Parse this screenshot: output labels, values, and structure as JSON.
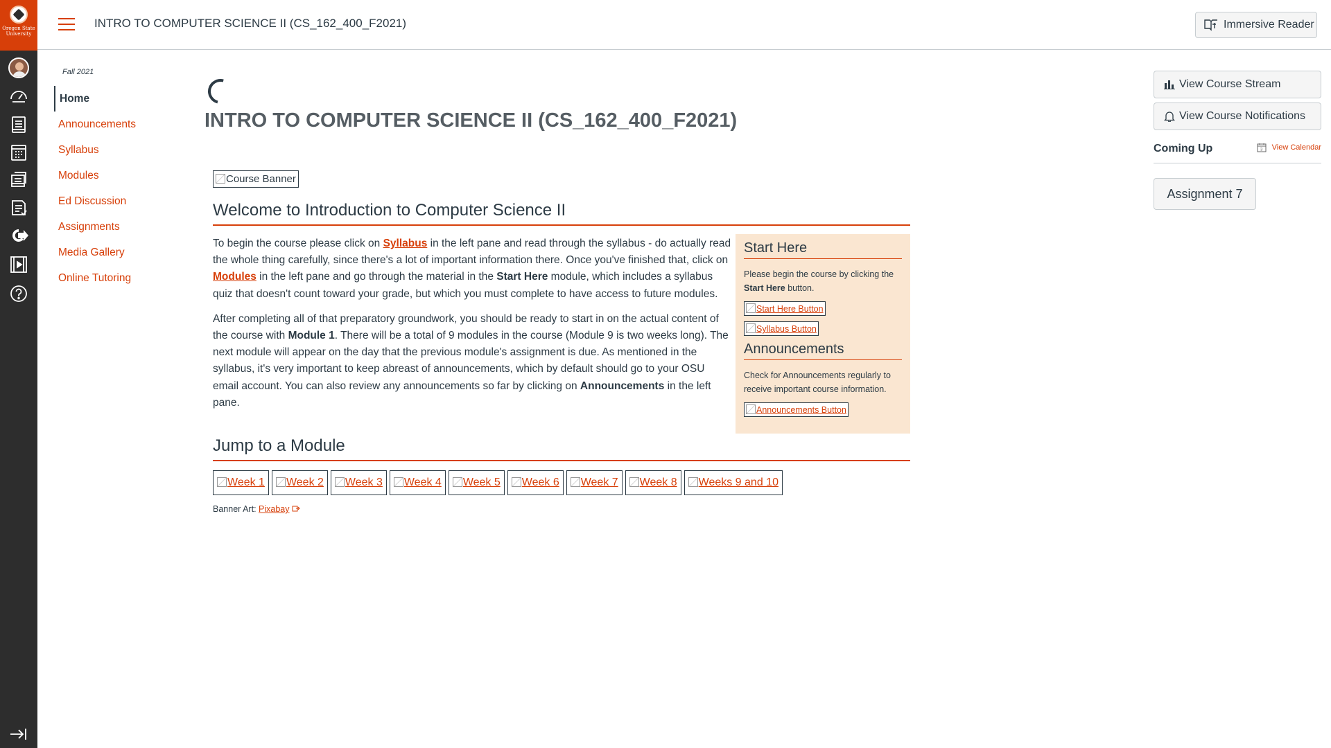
{
  "global_nav": {
    "logo_text": "Oregon State University",
    "items": [
      {
        "name": "account",
        "icon": "avatar-icon"
      },
      {
        "name": "dashboard",
        "icon": "dashboard-icon"
      },
      {
        "name": "courses",
        "icon": "courses-icon"
      },
      {
        "name": "calendar",
        "icon": "calendar-icon"
      },
      {
        "name": "inbox",
        "icon": "inbox-icon"
      },
      {
        "name": "history",
        "icon": "history-icon"
      },
      {
        "name": "commons",
        "icon": "commons-icon"
      },
      {
        "name": "studio",
        "icon": "studio-icon"
      },
      {
        "name": "help",
        "icon": "help-icon"
      }
    ],
    "collapse_icon": "collapse-nav-icon"
  },
  "header": {
    "course_title": "INTRO TO COMPUTER SCIENCE II (CS_162_400_F2021)",
    "immersive_reader": "Immersive Reader"
  },
  "course_nav": {
    "term": "Fall 2021",
    "items": [
      "Home",
      "Announcements",
      "Syllabus",
      "Modules",
      "Ed Discussion",
      "Assignments",
      "Media Gallery",
      "Online Tutoring"
    ],
    "active": "Home"
  },
  "main": {
    "title": "INTRO TO COMPUTER SCIENCE II (CS_162_400_F2021)",
    "banner_alt": "Course Banner",
    "welcome_heading": "Welcome to Introduction to Computer Science II",
    "p1": {
      "a": "To begin the course please click on ",
      "syllabus_link": "Syllabus",
      "b": " in the left pane and read through the syllabus - do actually read the whole thing carefully, since there's a lot of important information there. Once you've finished that, click on ",
      "modules_link": "Modules",
      "c": " in the left pane and go through the material in the ",
      "start_here": "Start Here",
      "d": " module, which includes a syllabus quiz that doesn't count toward your grade, but which you must complete to have access to future modules."
    },
    "p2": {
      "a": "After completing all of that preparatory groundwork, you should be ready to start in on the actual content of the course with ",
      "module1": "Module 1",
      "b": ". There will be a total of 9 modules in the course (Module 9 is two weeks long). The next module will appear on the day that the previous module's assignment is due. As mentioned in the syllabus, it's very important to keep abreast of announcements, which by default should go to your OSU email account. You can also review any announcements so far by clicking on ",
      "announcements": "Announcements",
      "c": " in the left pane."
    },
    "sidebox": {
      "start_heading": "Start Here",
      "start_text_a": "Please begin the course by clicking the ",
      "start_text_bold": "Start Here",
      "start_text_b": " button.",
      "start_btn": "Start Here Button",
      "syllabus_btn": "Syllabus Button",
      "ann_heading": "Announcements",
      "ann_text": "Check for Announcements regularly to receive important course information.",
      "ann_btn": "Announcements Button"
    },
    "jump_heading": "Jump to a Module",
    "weeks": [
      "Week 1",
      "Week 2",
      "Week 3",
      "Week 4",
      "Week 5",
      "Week 6",
      "Week 7",
      "Week 8",
      "Weeks 9 and 10"
    ],
    "banner_art_label": "Banner Art: ",
    "banner_art_link": "Pixabay"
  },
  "right_sidebar": {
    "view_stream": "View Course Stream",
    "view_notifications": "View Course Notifications",
    "coming_up": "Coming Up",
    "view_calendar": "View Calendar",
    "assignment": "Assignment 7"
  },
  "colors": {
    "accent": "#d73f09",
    "nav_bg": "#2d2d2d",
    "text": "#2d3b45",
    "sidebox_bg": "#fae6d1"
  }
}
